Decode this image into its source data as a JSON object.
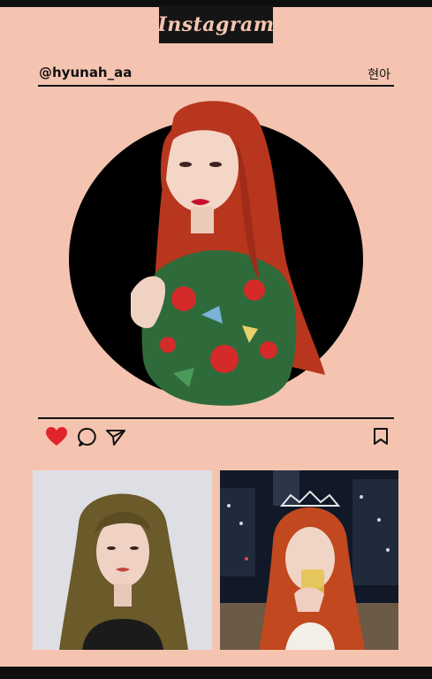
{
  "app": {
    "logo": "Instagram"
  },
  "profile": {
    "username": "@hyunah_aa",
    "display_name": "현아"
  },
  "actions": {
    "like_icon": "heart-icon",
    "comment_icon": "comment-icon",
    "share_icon": "paper-plane-icon",
    "save_icon": "bookmark-icon",
    "liked": true
  },
  "colors": {
    "background": "#f4c4b0",
    "dark": "#111111",
    "heart": "#e0242c",
    "hair": "#b8361e"
  }
}
